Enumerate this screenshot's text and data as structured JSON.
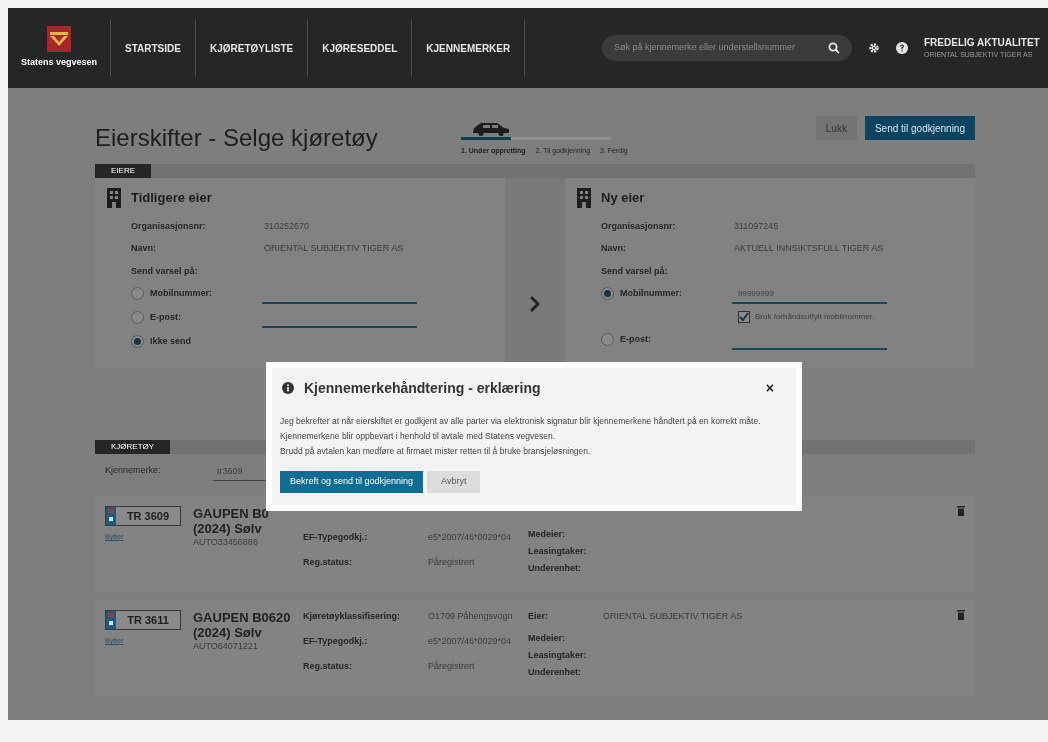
{
  "header": {
    "logo_text": "Statens vegvesen",
    "nav": [
      {
        "label": "STARTSIDE"
      },
      {
        "label": "KJØRETØYLISTE"
      },
      {
        "label": "KJØRESEDDEL"
      },
      {
        "label": "KJENNEMERKER"
      }
    ],
    "search": {
      "placeholder": "Søk på kjennemerke eller understellsnummer"
    },
    "user": {
      "name": "FREDELIG AKTUALITET",
      "org": "ORIENTAL SUBJEKTIV TIGER AS"
    }
  },
  "page": {
    "title": "Eierskifter - Selge kjøretøy",
    "steps": [
      {
        "label": "1. Under oppretting",
        "selected": true
      },
      {
        "label": "2. Til godkjenning",
        "selected": false
      },
      {
        "label": "3. Ferdig",
        "selected": false
      }
    ],
    "buttons": [
      {
        "label": "Lukk",
        "kind": "secondary"
      },
      {
        "label": "Send til godkjenning",
        "kind": "primary"
      }
    ]
  },
  "owners": {
    "section": "EIERE",
    "previous": {
      "title": "Tidligere eier",
      "fields": [
        {
          "label": "Organisasjonsnr:",
          "value": "310252670"
        },
        {
          "label": "Navn:",
          "value": "ORIENTAL SUBJEKTIV TIGER AS"
        }
      ],
      "notify_label": "Send varsel på:",
      "options": [
        {
          "label": "Mobilnummer:",
          "selected": false,
          "kind": "field"
        },
        {
          "label": "E-post:",
          "selected": false,
          "kind": "field"
        },
        {
          "label": "Ikke send",
          "selected": true,
          "kind": "plain"
        }
      ]
    },
    "new": {
      "title": "Ny eier",
      "fields": [
        {
          "label": "Organisasjonsnr:",
          "value": "311097245"
        },
        {
          "label": "Navn:",
          "value": "AKTUELL INNSIKTSFULL TIGER AS"
        }
      ],
      "notify_label": "Send varsel på:",
      "options": [
        {
          "label": "Mobilnummer:",
          "selected": true,
          "kind": "field",
          "value": "99999999",
          "checkbox": {
            "label": "Bruk forhåndsutfylt mobilnummer.",
            "checked": true
          }
        },
        {
          "label": "E-post:",
          "selected": false,
          "kind": "field"
        }
      ]
    }
  },
  "vehicles": {
    "section": "KJØRETØY",
    "filter": {
      "label": "Kjennemerke:",
      "value": "tr3609"
    },
    "items": [
      {
        "plate": "TR 3609",
        "link": "Bytter",
        "model": "GAUPEN B0",
        "year_color": "(2024) Sølv",
        "id": "AUTO33456886",
        "details": [
          {
            "label": "EF-Typegodkj.:",
            "value": "e5*2007/46*0029*04"
          },
          {
            "label": "Reg.status:",
            "value": "Påregistrert"
          }
        ],
        "parties": [
          {
            "label": "Medeier:"
          },
          {
            "label": "Leasingtaker:"
          },
          {
            "label": "Underenhet:"
          }
        ]
      },
      {
        "plate": "TR 3611",
        "link": "Bytter",
        "model": "GAUPEN B0620",
        "year_color": "(2024) Sølv",
        "id": "AUTO64071221",
        "details": [
          {
            "label": "Kjøretøyklassifisering:",
            "value": "O1709 Påhengsvogn"
          },
          {
            "label": "EF-Typegodkj.:",
            "value": "e5*2007/46*0029*04"
          },
          {
            "label": "Reg.status:",
            "value": "Påregistrert"
          }
        ],
        "parties": [
          {
            "label": "Eier:",
            "value": "ORIENTAL SUBJEKTIV TIGER AS"
          },
          {
            "label": "Medeier:"
          },
          {
            "label": "Leasingtaker:"
          },
          {
            "label": "Underenhet:"
          }
        ]
      }
    ]
  },
  "modal": {
    "title": "Kjennemerkehåndtering - erklæring",
    "close": "×",
    "paragraphs": [
      "Jeg bekrefter at når eierskiftet er godkjent av alle parter via elektronisk signatur blir kjennemerkene håndtert på en korrekt måte.",
      "Kjennemerkene blir oppbevart i henhold til avtale med Statens vegvesen.",
      "Brudd på avtalen kan medføre at firmaet mister retten til å bruke bransjeløsningen."
    ],
    "buttons": [
      {
        "label": "Bekreft og send til godkjenning",
        "kind": "primary"
      },
      {
        "label": "Avbryt",
        "kind": "secondary"
      }
    ]
  }
}
